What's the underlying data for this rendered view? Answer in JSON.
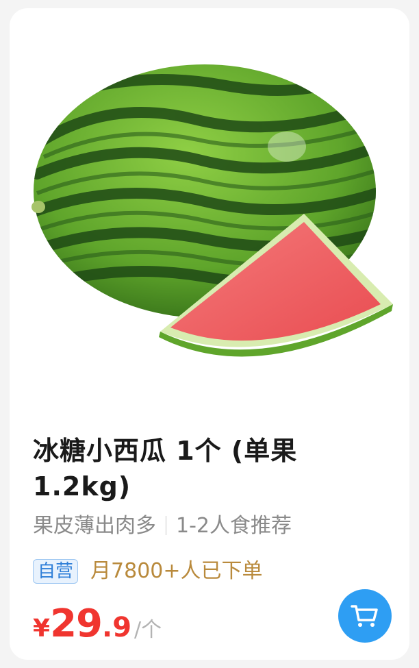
{
  "product": {
    "image_icon": "watermelon-image",
    "title": "冰糖小西瓜 1个 (单果1.2kg)",
    "feature_left": "果皮薄出肉多",
    "feature_right": "1-2人食推荐",
    "tag": "自营",
    "sales": "月7800+人已下单",
    "price": {
      "currency": "¥",
      "integer": "29",
      "decimal": ".9",
      "unit": "/个"
    }
  },
  "cart_button": {
    "icon": "cart-icon"
  },
  "colors": {
    "price": "#f0352f",
    "tag": "#2f7fd8",
    "sales": "#b98a3c",
    "cart_button": "#2e9ef3"
  }
}
